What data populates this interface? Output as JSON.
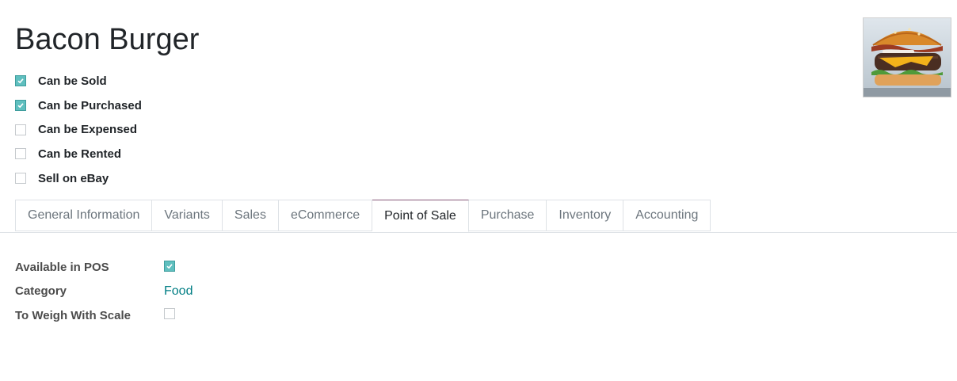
{
  "product": {
    "name": "Bacon Burger",
    "image_icon": "burger-photo"
  },
  "options": [
    {
      "label": "Can be Sold",
      "checked": true
    },
    {
      "label": "Can be Purchased",
      "checked": true
    },
    {
      "label": "Can be Expensed",
      "checked": false
    },
    {
      "label": "Can be Rented",
      "checked": false
    },
    {
      "label": "Sell on eBay",
      "checked": false
    }
  ],
  "tabs": [
    {
      "label": "General Information",
      "active": false
    },
    {
      "label": "Variants",
      "active": false
    },
    {
      "label": "Sales",
      "active": false
    },
    {
      "label": "eCommerce",
      "active": false
    },
    {
      "label": "Point of Sale",
      "active": true
    },
    {
      "label": "Purchase",
      "active": false
    },
    {
      "label": "Inventory",
      "active": false
    },
    {
      "label": "Accounting",
      "active": false
    }
  ],
  "pos": {
    "available_label": "Available in POS",
    "available_checked": true,
    "category_label": "Category",
    "category_value": "Food",
    "weigh_label": "To Weigh With Scale",
    "weigh_checked": false
  },
  "colors": {
    "checkbox_checked": "#5fbfbf",
    "link": "#017e84",
    "active_tab_accent": "#875a7b"
  }
}
